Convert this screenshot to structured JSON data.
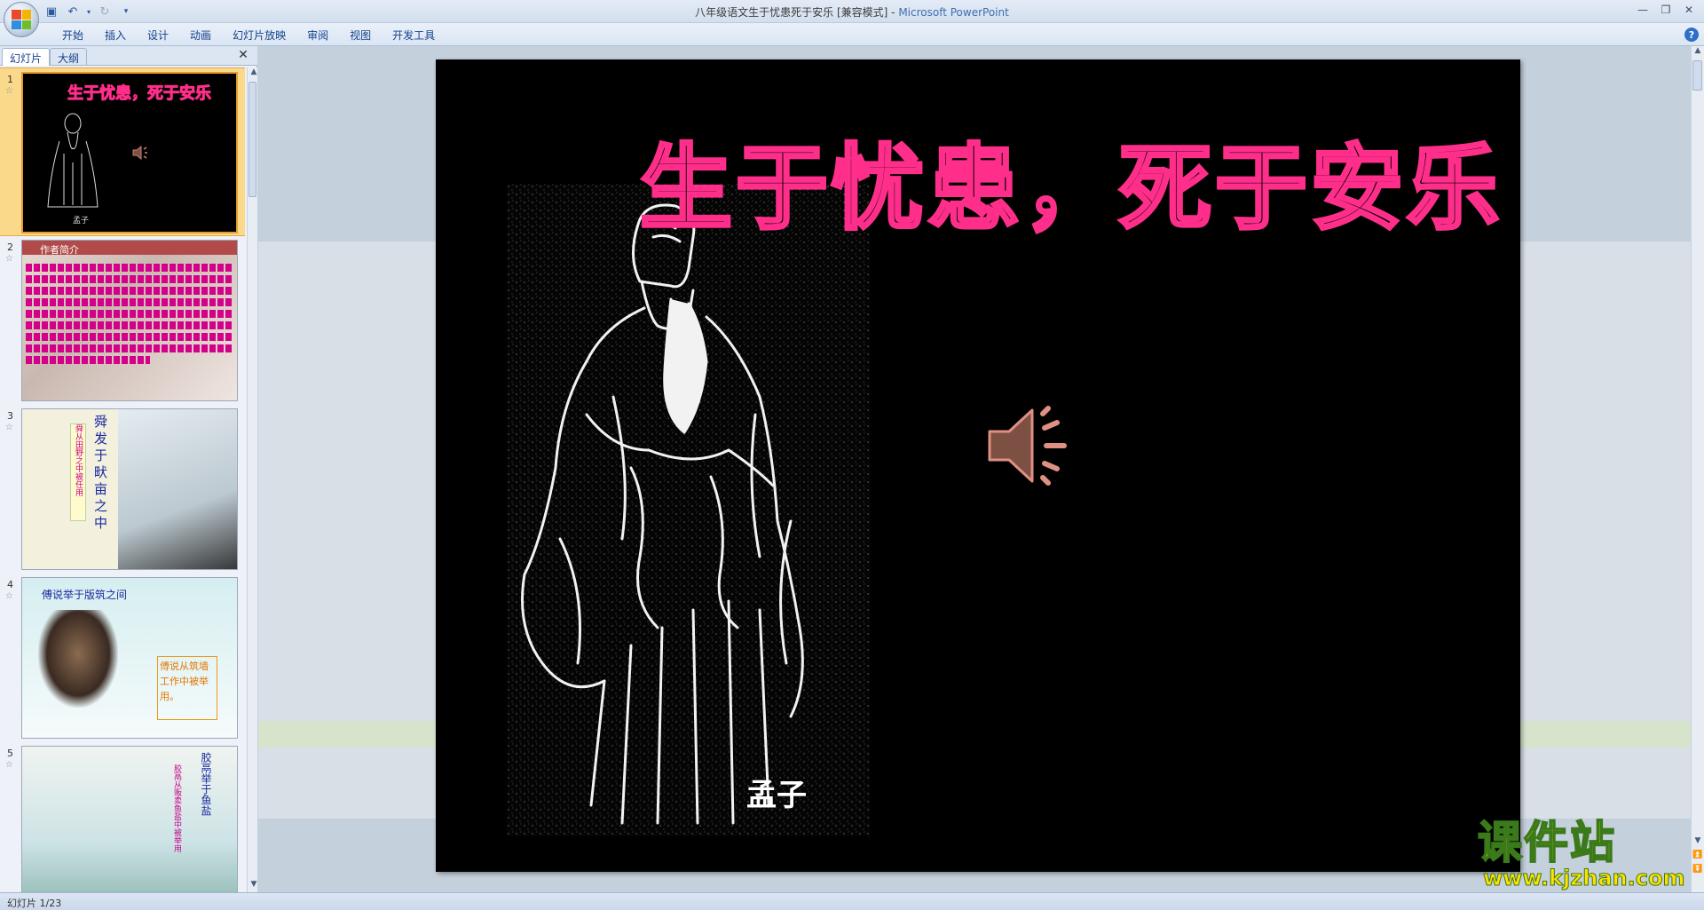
{
  "window": {
    "title": "八年级语文生于忧患死于安乐 [兼容模式]",
    "app_name": "Microsoft PowerPoint",
    "title_sep": " - "
  },
  "ribbon": {
    "tabs": [
      "开始",
      "插入",
      "设计",
      "动画",
      "幻灯片放映",
      "审阅",
      "视图",
      "开发工具"
    ]
  },
  "left_pane": {
    "tabs": [
      "幻灯片",
      "大纲"
    ],
    "thumbnails": [
      {
        "num": "1",
        "title": "生于忧患，死于安乐",
        "caption": "孟子"
      },
      {
        "num": "2",
        "title": "作者简介"
      },
      {
        "num": "3",
        "text_a": "舜发于畎亩之中",
        "text_b": "舜从田野之中被任用"
      },
      {
        "num": "4",
        "title": "傅说举于版筑之间",
        "box": "傅说从筑墙工作中被举用。"
      },
      {
        "num": "5",
        "text_a": "胶鬲举于鱼盐",
        "text_b": "胶鬲从贩卖鱼盐中被举用"
      }
    ]
  },
  "slide": {
    "title": "生于忧患，死于安乐",
    "portrait_caption": "孟子"
  },
  "status": {
    "slide_indicator": "幻灯片 1/23"
  },
  "watermark": {
    "cn": "课件站",
    "url": "www.kjzhan.com"
  },
  "colors": {
    "title_stroke": "#ff2e8a",
    "selected_thumb": "#fbd98a",
    "watermark_fill": "#ffe000"
  }
}
